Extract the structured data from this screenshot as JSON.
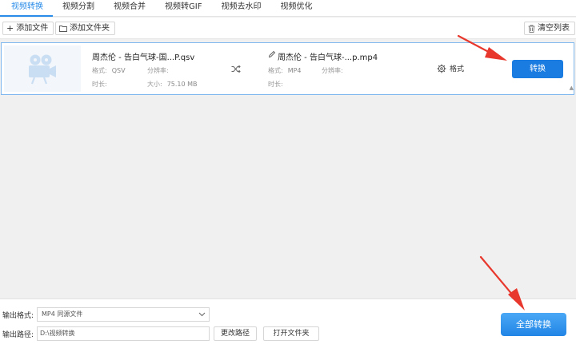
{
  "tabs": [
    {
      "label": "视频转换",
      "active": true
    },
    {
      "label": "视频分割"
    },
    {
      "label": "视频合并"
    },
    {
      "label": "视频转GIF"
    },
    {
      "label": "视频去水印"
    },
    {
      "label": "视频优化"
    }
  ],
  "toolbar": {
    "add_file": "添加文件",
    "add_folder": "添加文件夹",
    "clear_list": "清空列表"
  },
  "file": {
    "source": {
      "name": "周杰伦 - 告白气球-国...P.qsv",
      "format_label": "格式:",
      "format": "QSV",
      "resolution_label": "分辨率:",
      "resolution": "",
      "duration_label": "时长:",
      "duration": "",
      "size_label": "大小:",
      "size": "75.10 MB"
    },
    "output": {
      "name": "周杰伦 - 告白气球-...p.mp4",
      "format_label": "格式:",
      "format": "MP4",
      "resolution_label": "分辨率:",
      "resolution": "",
      "duration_label": "时长:",
      "duration": ""
    },
    "settings_label": "格式",
    "convert_label": "转换"
  },
  "bottom": {
    "output_format_label": "输出格式:",
    "output_format_value": "MP4  同源文件",
    "output_path_label": "输出路径:",
    "output_path_value": "D:\\视频转换",
    "change_path": "更改路径",
    "open_folder": "打开文件夹",
    "convert_all": "全部转换"
  },
  "colors": {
    "accent": "#2a8ce8",
    "button": "#1a7be0",
    "arrow": "#e8372c"
  }
}
